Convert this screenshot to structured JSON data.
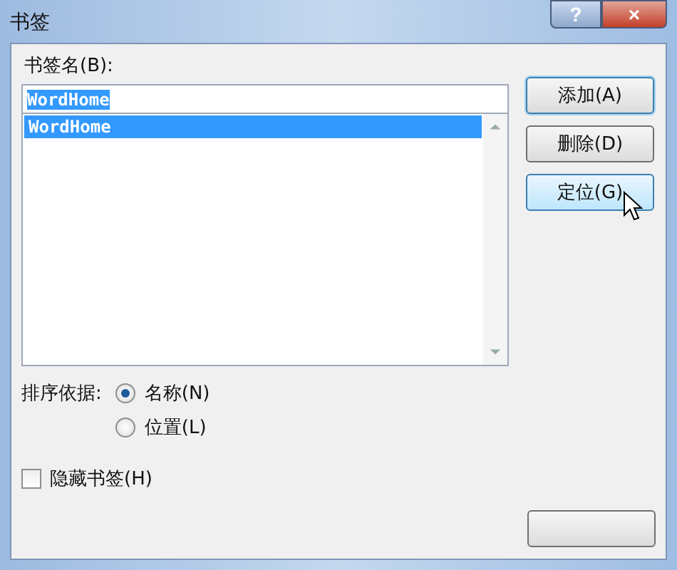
{
  "window": {
    "title": "书签",
    "help": "?",
    "close": "×"
  },
  "name_label": "书签名(B):",
  "name_field": {
    "value": "WordHome"
  },
  "bookmarks": [
    {
      "label": "WordHome",
      "selected": true
    }
  ],
  "buttons": [
    {
      "label": "添加(A)",
      "focused": true,
      "hover": false
    },
    {
      "label": "删除(D)",
      "focused": false,
      "hover": false
    },
    {
      "label": "定位(G)",
      "focused": false,
      "hover": true
    }
  ],
  "sort": {
    "label": "排序依据:",
    "options": [
      {
        "label": "名称(N)",
        "selected": true
      },
      {
        "label": "位置(L)",
        "selected": false
      }
    ]
  },
  "hidden": {
    "label": "隐藏书签(H)",
    "checked": false
  }
}
